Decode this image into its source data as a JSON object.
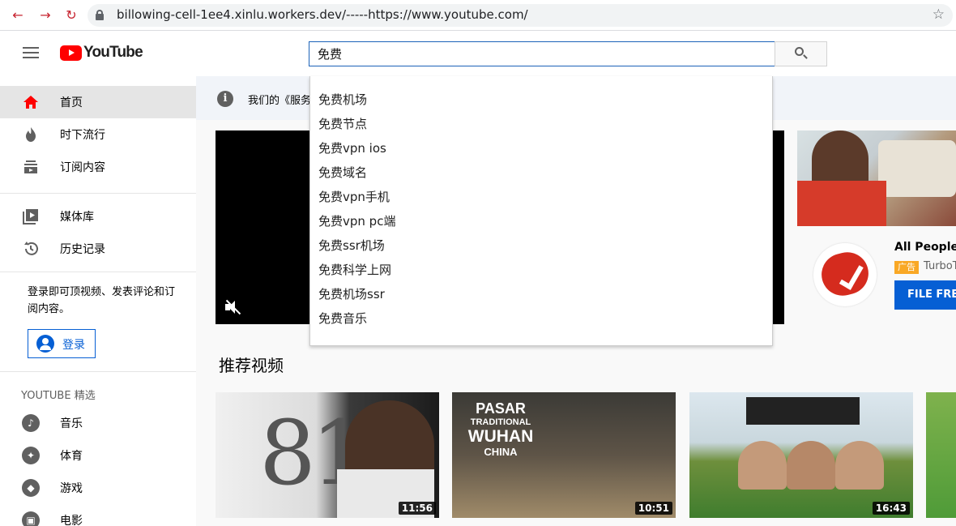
{
  "browser": {
    "url": "billowing-cell-1ee4.xinlu.workers.dev/-----https://www.youtube.com/"
  },
  "header": {
    "logo_text": "YouTube",
    "search_value": "免费"
  },
  "suggestions": [
    "免费机场",
    "免费节点",
    "免费vpn ios",
    "免费域名",
    "免费vpn手机",
    "免费vpn pc端",
    "免费ssr机场",
    "免费科学上网",
    "免费机场ssr",
    "免费音乐"
  ],
  "sidebar": {
    "items": [
      {
        "label": "首页",
        "icon": "home-icon"
      },
      {
        "label": "时下流行",
        "icon": "trending-icon"
      },
      {
        "label": "订阅内容",
        "icon": "subscriptions-icon"
      },
      {
        "label": "媒体库",
        "icon": "library-icon"
      },
      {
        "label": "历史记录",
        "icon": "history-icon"
      }
    ],
    "signin_prompt": "登录即可顶视频、发表评论和订阅内容。",
    "signin_label": "登录",
    "best_title": "YOUTUBE 精选",
    "best_items": [
      {
        "label": "音乐",
        "icon": "music-icon"
      },
      {
        "label": "体育",
        "icon": "sports-icon"
      },
      {
        "label": "游戏",
        "icon": "gaming-icon"
      },
      {
        "label": "电影",
        "icon": "movies-icon"
      }
    ]
  },
  "banner": {
    "text": "我们的《服务"
  },
  "ad": {
    "title": "All People A",
    "badge": "广告",
    "advertiser": "TurboT",
    "cta": "FILE FREE"
  },
  "recommended": {
    "title": "推荐视频",
    "videos": [
      {
        "duration": "11:56",
        "overlay": "81"
      },
      {
        "duration": "10:51",
        "overlay_lines": [
          "PASAR",
          "TRADITIONAL",
          "WUHAN",
          "CHINA"
        ]
      },
      {
        "duration": "16:43"
      },
      {}
    ]
  },
  "colors": {
    "accent": "#ff0000",
    "link_blue": "#065fd4",
    "search_border": "#1c62b9"
  }
}
